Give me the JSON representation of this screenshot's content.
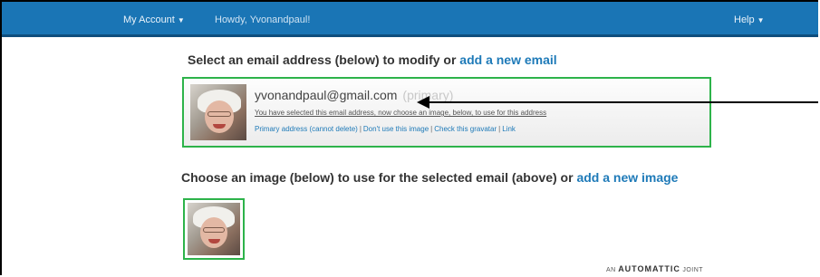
{
  "topbar": {
    "my_account": "My Account",
    "greeting": "Howdy, Yvonandpaul!",
    "help": "Help"
  },
  "heading_select": {
    "text": "Select an email address (below) to modify or",
    "link": "add a new email"
  },
  "email_card": {
    "address": "yvonandpaul@gmail.com",
    "tag": "(primary)",
    "note": "You have selected this email address, now choose an image, below, to use for this address",
    "actions": [
      "Primary address (cannot delete)",
      "Don't use this image",
      "Check this gravatar",
      "Link"
    ]
  },
  "heading_choose": {
    "text": "Choose an image (below) to use for the selected email (above) or",
    "link": "add a new image"
  },
  "footer": {
    "prefix": "AN",
    "brand": "AUTOMATTIC",
    "suffix": "JOINT"
  },
  "colors": {
    "topbar": "#1a75b5",
    "link": "#1e7ab8",
    "selection_border": "#2db34a"
  }
}
